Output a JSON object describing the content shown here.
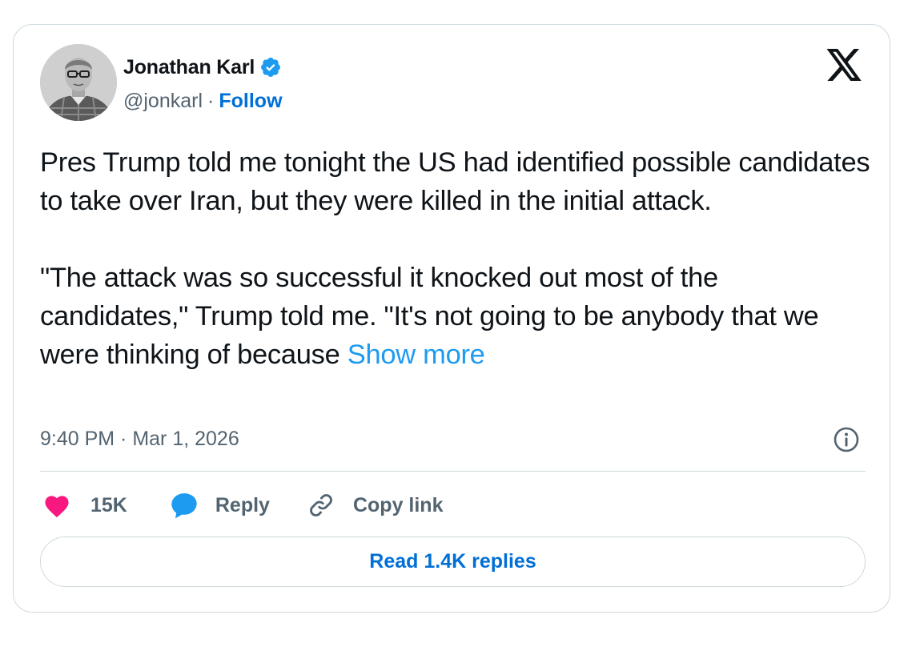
{
  "author": {
    "name": "Jonathan Karl",
    "handle": "@jonkarl",
    "separator": "·",
    "follow_label": "Follow",
    "verified_color": "#1d9bf0"
  },
  "tweet": {
    "paragraphs": [
      "Pres Trump told me tonight the US had identified possible candidates to take over Iran, but they were killed in the initial attack.",
      "\"The attack was so successful it knocked out most of the candidates,\" Trump told me. \"It's not going to be anybody that we were thinking of because "
    ],
    "show_more_label": "Show more",
    "timestamp": "9:40 PM · Mar 1, 2026"
  },
  "actions": {
    "like_count": "15K",
    "reply_label": "Reply",
    "copy_link_label": "Copy link"
  },
  "read_replies_label": "Read 1.4K replies",
  "icons": {
    "brand": "x-logo-icon",
    "info": "info-icon",
    "like": "heart-icon",
    "reply": "speech-bubble-icon",
    "copy": "link-icon",
    "verified": "verified-badge-icon"
  },
  "colors": {
    "like": "#f91880",
    "reply": "#1d9bf0",
    "link_text": "#006fd6",
    "show_more": "#1d9bf0",
    "muted": "#536471",
    "border": "#cfd9de"
  }
}
